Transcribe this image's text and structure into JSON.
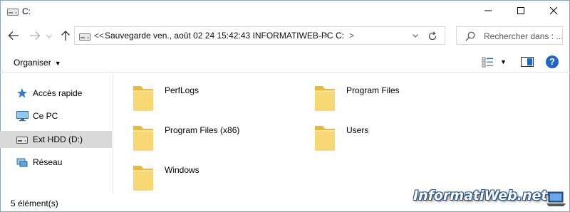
{
  "window": {
    "title": "C:"
  },
  "address": {
    "overflow": "<<",
    "path": "Sauvegarde ven., août 02 24 15:42:43 INFORMATIWEB-PC",
    "separator": ">",
    "current": "C:"
  },
  "search": {
    "placeholder": "Rechercher dans : ..."
  },
  "toolbar": {
    "organiser_label": "Organiser",
    "help_label": "?"
  },
  "sidebar": {
    "items": [
      {
        "label": "Accès rapide",
        "icon": "star-icon"
      },
      {
        "label": "Ce PC",
        "icon": "computer-icon"
      },
      {
        "label": "Ext HDD (D:)",
        "icon": "drive-icon",
        "selected": true
      },
      {
        "label": "Réseau",
        "icon": "network-icon"
      }
    ]
  },
  "files": [
    {
      "name": "PerfLogs",
      "icon": "folder-icon"
    },
    {
      "name": "Program Files",
      "icon": "folder-icon"
    },
    {
      "name": "Program Files (x86)",
      "icon": "folder-icon"
    },
    {
      "name": "Users",
      "icon": "folder-icon"
    },
    {
      "name": "Windows",
      "icon": "folder-icon"
    }
  ],
  "status": {
    "count": "5 élément(s)"
  },
  "watermark": {
    "text": "InformatiWeb.net"
  },
  "colors": {
    "folder": "#f8d775",
    "folder_dark": "#e8b93b",
    "selection": "#d9d9d9",
    "accent": "#1e66c8"
  }
}
